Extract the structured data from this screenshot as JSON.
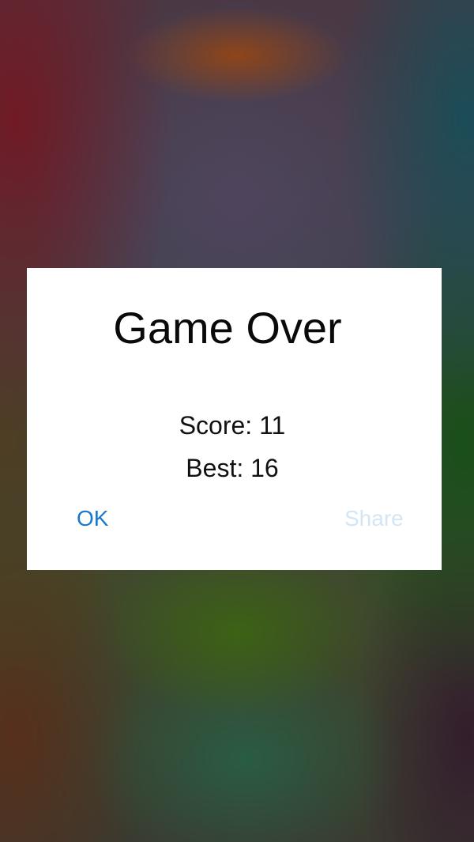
{
  "dialog": {
    "title": "Game Over",
    "score_text": "Score: 11",
    "best_text": "Best: 16",
    "ok_label": "OK",
    "share_label": "Share"
  },
  "game": {
    "score": 11,
    "best": 16
  },
  "colors": {
    "ok": "#1a78cc",
    "share_disabled": "#d3e6f6",
    "dialog_bg": "#ffffff"
  }
}
